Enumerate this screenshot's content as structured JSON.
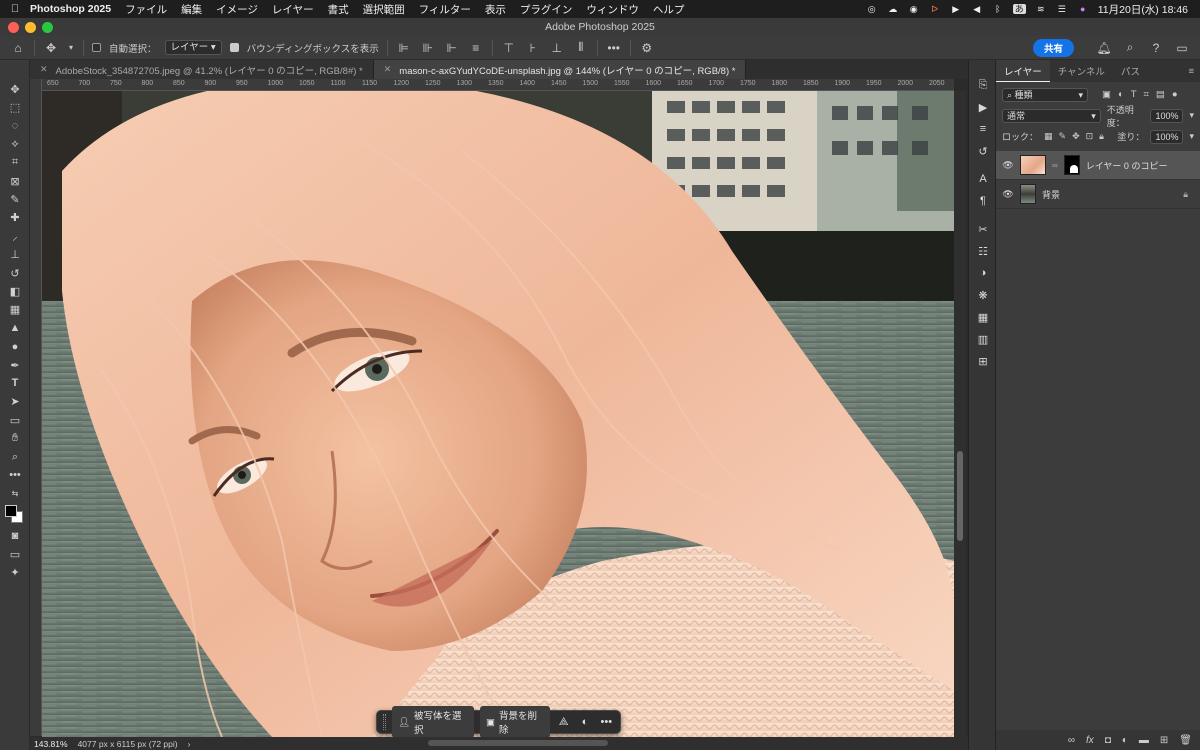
{
  "menubar": {
    "app_name": "Photoshop 2025",
    "items": [
      "ファイル",
      "編集",
      "イメージ",
      "レイヤー",
      "書式",
      "選択範囲",
      "フィルター",
      "表示",
      "プラグイン",
      "ウィンドウ",
      "ヘルプ"
    ],
    "ime_label": "あ",
    "datetime": "11月20日(水)  18:46"
  },
  "window": {
    "title": "Adobe Photoshop 2025"
  },
  "optionsbar": {
    "auto_select_label": "自動選択：",
    "auto_select_value": "レイヤー",
    "bounding_box_label": "バウンディングボックスを表示",
    "share_label": "共有"
  },
  "tabs": [
    {
      "label": "AdobeStock_354872705.jpeg @ 41.2% (レイヤー 0 のコピー, RGB/8#) *",
      "active": false
    },
    {
      "label": "mason-c-axGYudYCoDE-unsplash.jpg @ 144% (レイヤー 0 のコピー, RGB/8) *",
      "active": true
    }
  ],
  "ruler_labels": [
    "650",
    "700",
    "750",
    "800",
    "850",
    "900",
    "950",
    "1000",
    "1050",
    "1100",
    "1150",
    "1200",
    "1250",
    "1300",
    "1350",
    "1400",
    "1450",
    "1500",
    "1550",
    "1600",
    "1650",
    "1700",
    "1750",
    "1800",
    "1850",
    "1900",
    "1950",
    "2000",
    "2050"
  ],
  "contextbar": {
    "select_subject": "被写体を選択",
    "remove_background": "背景を削除"
  },
  "statusbar": {
    "zoom": "143.81%",
    "doc_size": "4077 px x 6115 px (72 ppi)"
  },
  "layers_panel": {
    "tabs": [
      "レイヤー",
      "チャンネル",
      "パス"
    ],
    "filter_kind": "種類",
    "blend_mode": "通常",
    "opacity_label": "不透明度：",
    "opacity_value": "100%",
    "lock_label": "ロック：",
    "fill_label": "塗り：",
    "fill_value": "100%",
    "layers": [
      {
        "name": "レイヤー 0 のコピー",
        "active": true
      },
      {
        "name": "背景",
        "active": false
      }
    ]
  },
  "colors": {
    "accent": "#1473e6",
    "close": "#ff5f57",
    "minimize": "#febc2e",
    "zoom": "#28c840"
  }
}
